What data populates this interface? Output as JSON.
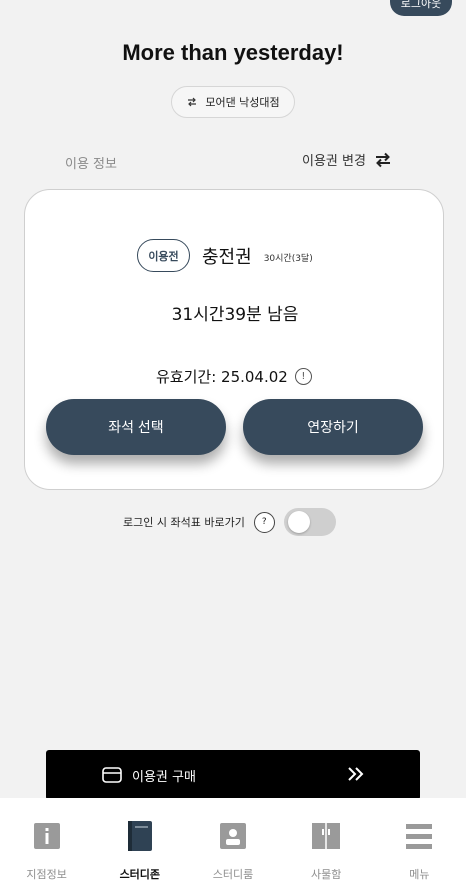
{
  "header": {
    "logout_label": "로그아웃",
    "headline": "More than yesterday!",
    "branch": "모어댄 낙성대점"
  },
  "section": {
    "label": "이용 정보",
    "change_label": "이용권 변경"
  },
  "ticket": {
    "status": "이용전",
    "name": "충전권",
    "spec": "30시간(3달)",
    "remaining": "31시간39분 남음",
    "validity": "유효기간: 25.04.02",
    "info_glyph": "!",
    "seat_button": "좌석 선택",
    "extend_button": "연장하기"
  },
  "shortcut": {
    "label": "로그인 시 좌석표 바로가기",
    "help_glyph": "?",
    "enabled": false
  },
  "purchase": {
    "label": "이용권 구매",
    "icon": "wallet-icon",
    "arrow_icon": "double-chevron-right-icon"
  },
  "nav": {
    "items": [
      {
        "label": "지점정보",
        "icon": "info-icon",
        "active": false
      },
      {
        "label": "스터디존",
        "icon": "book-icon",
        "active": true
      },
      {
        "label": "스터디룸",
        "icon": "room-icon",
        "active": false
      },
      {
        "label": "사물함",
        "icon": "locker-icon",
        "active": false
      },
      {
        "label": "메뉴",
        "icon": "menu-icon",
        "active": false
      }
    ]
  },
  "colors": {
    "accent": "#374a5c",
    "background": "#f2f2f2",
    "purchase_bar": "#000000"
  }
}
